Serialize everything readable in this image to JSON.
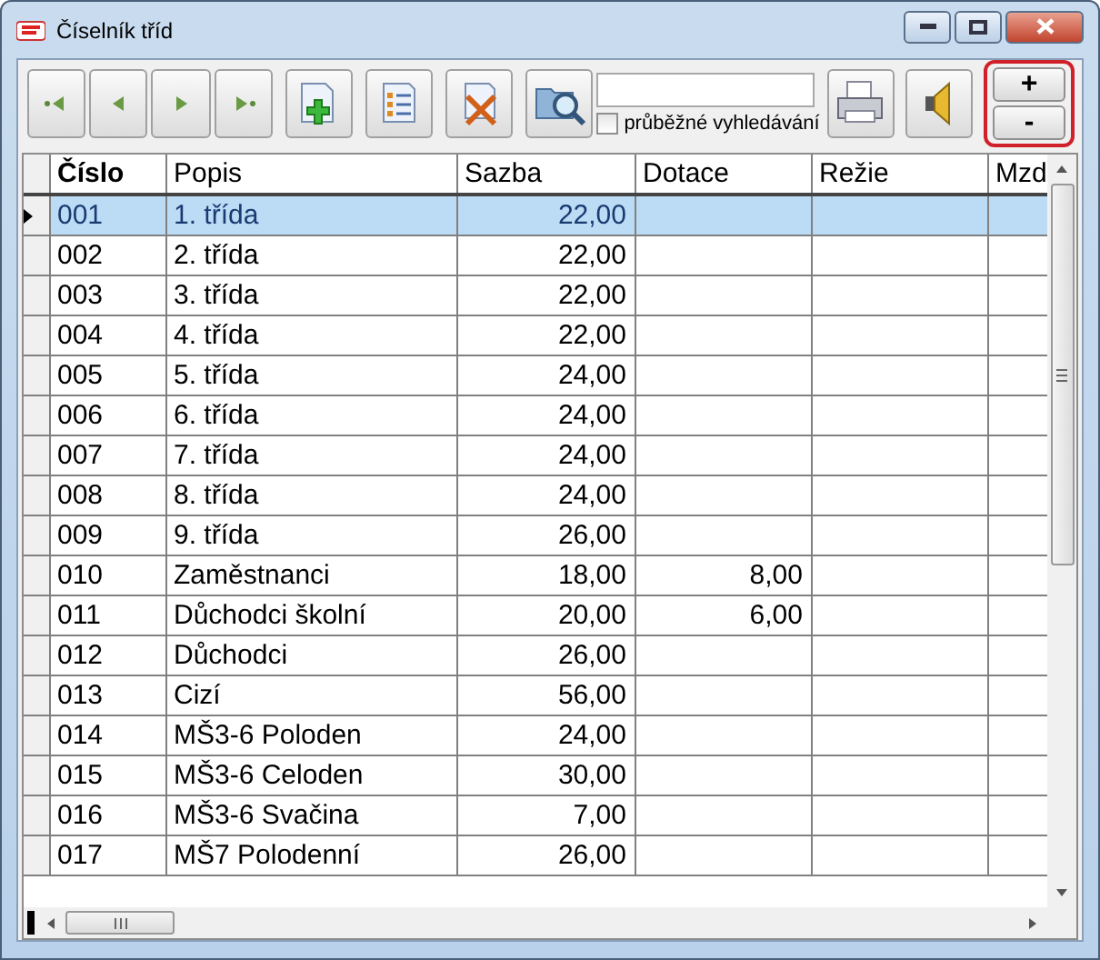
{
  "window": {
    "title": "Číselník tříd"
  },
  "toolbar": {
    "buttons": [
      {
        "kind": "first"
      },
      {
        "kind": "prev"
      },
      {
        "kind": "next"
      },
      {
        "kind": "last"
      },
      {
        "kind": "add"
      },
      {
        "kind": "edit"
      },
      {
        "kind": "delete"
      },
      {
        "kind": "find"
      }
    ],
    "search": {
      "live_search": {
        "label": "průběžné vyhledávání",
        "checked": false
      }
    },
    "right_buttons": [
      {
        "kind": "print"
      },
      {
        "kind": "sound"
      }
    ],
    "zoom": {
      "highlighted": true,
      "buttons": [
        "+",
        "-"
      ]
    }
  },
  "table": {
    "columns": [
      {
        "label": "Číslo",
        "sorted": true
      },
      {
        "label": "Popis",
        "sorted": false
      },
      {
        "label": "Sazba",
        "sorted": false
      },
      {
        "label": "Dotace",
        "sorted": false
      },
      {
        "label": "Režie",
        "sorted": false
      },
      {
        "label": "Mzd",
        "sorted": false
      }
    ],
    "rows": [
      {
        "cells": [
          "001",
          "1. třída",
          "22,00",
          "",
          "",
          ""
        ],
        "selected": true
      },
      {
        "cells": [
          "002",
          "2. třída",
          "22,00",
          "",
          "",
          ""
        ],
        "selected": false
      },
      {
        "cells": [
          "003",
          "3. třída",
          "22,00",
          "",
          "",
          ""
        ],
        "selected": false
      },
      {
        "cells": [
          "004",
          "4. třída",
          "22,00",
          "",
          "",
          ""
        ],
        "selected": false
      },
      {
        "cells": [
          "005",
          "5. třída",
          "24,00",
          "",
          "",
          ""
        ],
        "selected": false
      },
      {
        "cells": [
          "006",
          "6. třída",
          "24,00",
          "",
          "",
          ""
        ],
        "selected": false
      },
      {
        "cells": [
          "007",
          "7. třída",
          "24,00",
          "",
          "",
          ""
        ],
        "selected": false
      },
      {
        "cells": [
          "008",
          "8. třída",
          "24,00",
          "",
          "",
          ""
        ],
        "selected": false
      },
      {
        "cells": [
          "009",
          "9. třída",
          "26,00",
          "",
          "",
          ""
        ],
        "selected": false
      },
      {
        "cells": [
          "010",
          "Zaměstnanci",
          "18,00",
          "8,00",
          "",
          ""
        ],
        "selected": false
      },
      {
        "cells": [
          "011",
          "Důchodci školní",
          "20,00",
          "6,00",
          "",
          ""
        ],
        "selected": false
      },
      {
        "cells": [
          "012",
          "Důchodci",
          "26,00",
          "",
          "",
          ""
        ],
        "selected": false
      },
      {
        "cells": [
          "013",
          "Cizí",
          "56,00",
          "",
          "",
          ""
        ],
        "selected": false
      },
      {
        "cells": [
          "014",
          "MŠ3-6 Poloden",
          "24,00",
          "",
          "",
          ""
        ],
        "selected": false
      },
      {
        "cells": [
          "015",
          "MŠ3-6 Celoden",
          "30,00",
          "",
          "",
          ""
        ],
        "selected": false
      },
      {
        "cells": [
          "016",
          "MŠ3-6 Svačina",
          "7,00",
          "",
          "",
          ""
        ],
        "selected": false
      },
      {
        "cells": [
          "017",
          "MŠ7 Polodenní",
          "26,00",
          "",
          "",
          ""
        ],
        "selected": false
      }
    ]
  }
}
